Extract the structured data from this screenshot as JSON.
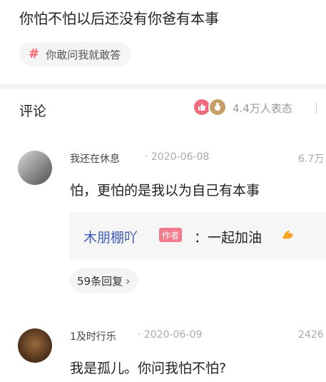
{
  "question": {
    "title": "你怕不怕以后还没有你爸有本事"
  },
  "topic": {
    "hash_glyph": "#",
    "text": "你敢问我就敢答"
  },
  "comments_header": {
    "title": "评论",
    "reaction_summary": "4.4万人表态",
    "reaction_icons": [
      "thumb-icon",
      "medal-icon"
    ]
  },
  "comments": [
    {
      "username": "我还在休息",
      "date": "· 2020-06-08",
      "likes": "6.7万",
      "text": "怕，更怕的是我以为自己有本事",
      "reply": {
        "author": "木朋棚吖",
        "badge": "作者",
        "text": "：一起加油"
      },
      "replies_label": "59条回复"
    },
    {
      "username": "1及时行乐",
      "date": "· 2020-06-09",
      "likes": "2426",
      "text": "我是孤儿。你问我怕不怕?"
    }
  ],
  "colors": {
    "accent_pink": "#ff5f6d",
    "author_badge": "#f27a8c",
    "reply_author": "#3f5fb5"
  }
}
